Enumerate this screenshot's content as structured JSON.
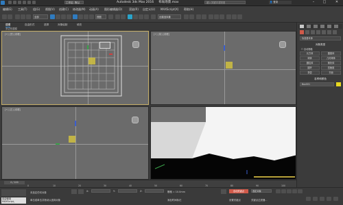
{
  "app": {
    "title": "Autodesk 3ds Max 2016",
    "file_name": "布局场景.max",
    "workspace": "工作区: 默认",
    "search_placeholder": "键入关键字或短语",
    "sign_in": "登录",
    "window_buttons": [
      "–",
      "□",
      "✕"
    ]
  },
  "menu": [
    "编辑(E)",
    "工具(T)",
    "组(G)",
    "视图(V)",
    "创建(C)",
    "修改器(M)",
    "动画(A)",
    "图形编辑器(D)",
    "渲染(R)",
    "自定义(U)",
    "MAXScript(X)",
    "帮助(H)"
  ],
  "toolbar": {
    "selection_filter": "全部",
    "view_dropdown": "视图",
    "named_selection": "创建选择集"
  },
  "ribbon": {
    "tabs": [
      "建模",
      "自由形式",
      "选择",
      "对象绘制",
      "填充"
    ],
    "sub_label": "多边形建模"
  },
  "viewports": {
    "top_left": "[+] [顶] [线框]",
    "top_right": "[+] [前] [线框]",
    "bottom_left": "[+] [左] [线框]",
    "bottom_right": "[+] [透视] [真实]"
  },
  "command_panel": {
    "dropdown": "标准基本体",
    "section_object_type": "对象类型",
    "autogrid_label": "自动栅格",
    "buttons": [
      "长方体",
      "圆锥体",
      "球体",
      "几何球体",
      "圆柱体",
      "管状体",
      "圆环",
      "四棱锥",
      "茶壶",
      "平面"
    ],
    "section_name_color": "名称和颜色",
    "name_value": "Box001",
    "accent_color": "#e8d820"
  },
  "timeline": {
    "slider_label": "0 / 100",
    "ticks": [
      "0",
      "10",
      "20",
      "30",
      "40",
      "50",
      "60",
      "70",
      "80",
      "90",
      "100"
    ]
  },
  "status": {
    "mode_text": "欢迎使用 MAXScript。",
    "selection": "未选定任何对象",
    "prompt": "单击或单击并拖动以选择对象",
    "add_time_tag": "添加时间标记",
    "x_label": "X:",
    "x_value": "",
    "y_label": "Y:",
    "y_value": "",
    "z_label": "Z:",
    "z_value": "",
    "grid": "栅格 = 10.0mm",
    "auto_key": "自动关键点",
    "selected": "选定对象",
    "set_key": "设置关键点",
    "key_filters": "关键点过滤器..."
  }
}
